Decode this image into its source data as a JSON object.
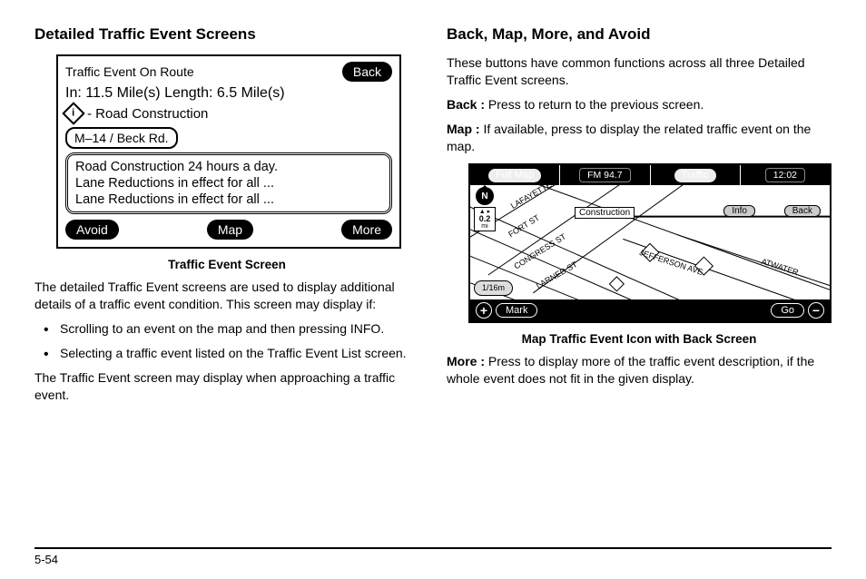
{
  "left": {
    "heading": "Detailed Traffic Event Screens",
    "caption": "Traffic Event Screen",
    "para1": "The detailed Traffic Event screens are used to display additional details of a traffic event condition. This screen may display if:",
    "bullet1": "Scrolling to an event on the map and then pressing INFO.",
    "bullet2": "Selecting a traffic event listed on the Traffic Event List screen.",
    "para2": "The Traffic Event screen may display when approaching a traffic event."
  },
  "right": {
    "heading": "Back, Map, More, and Avoid",
    "intro": "These buttons have common functions across all three Detailed Traffic Event screens.",
    "back_label": "Back :",
    "back_text": " Press to return to the previous screen.",
    "map_label": "Map :",
    "map_text": " If available, press to display the related traffic event on the map.",
    "caption": "Map Traffic Event Icon with Back Screen",
    "more_label": "More :",
    "more_text": " Press to display more of the traffic event description, if the whole event does not fit in the given display."
  },
  "fig1": {
    "title": "Traffic Event On Route",
    "back": "Back",
    "dist": "In: 11.5 Mile(s)  Length: 6.5 Mile(s)",
    "icon_letter": "i",
    "event_type": "- Road Construction",
    "road": "M–14 / Beck Rd.",
    "desc1": "Road Construction 24 hours a day.",
    "desc2": "Lane Reductions in effect for all ...",
    "desc3": "Lane Reductions in effect for all ...",
    "avoid": "Avoid",
    "map": "Map",
    "more": "More"
  },
  "fig2": {
    "fullmap": "Full Map",
    "radio": "FM 94.7",
    "traffic": "Traffic",
    "time": "12:02",
    "north": "N",
    "scale_val": "0.2",
    "scale_unit": "mi",
    "construction": "Construction",
    "info": "Info",
    "back": "Back",
    "scale_chip": "1/16m",
    "mark": "Mark",
    "go": "Go",
    "plus": "+",
    "minus": "−",
    "streets": {
      "lafayette": "LAFAYETTE",
      "fort": "FORT ST",
      "congress": "CONGRESS ST",
      "larned": "LARNED ST",
      "jefferson": "JEFFERSON AVE",
      "atwater": "ATWATER"
    }
  },
  "page": "5-54"
}
